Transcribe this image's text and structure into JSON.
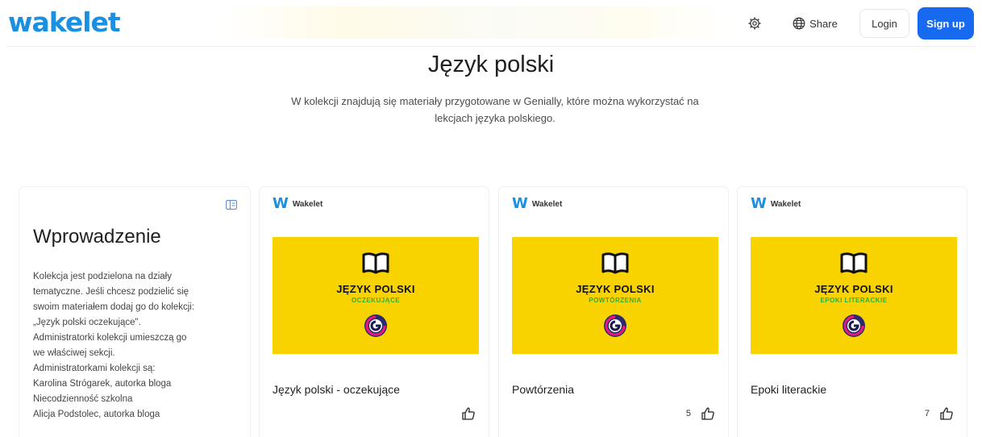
{
  "header": {
    "logo": "wakelet",
    "share_label": "Share",
    "login_label": "Login",
    "signup_label": "Sign up",
    "brand_color": "#1b8fe0",
    "signup_color": "#1769f0"
  },
  "collection": {
    "title": "Język polski",
    "description_lines": [
      "W kolekcji znajdują się materiały przygotowane w Genially, które można wykorzystać na",
      "lekcjach języka polskiego."
    ]
  },
  "intro": {
    "title": "Wprowadzenie",
    "lines": [
      "Kolekcja jest podzielona na działy",
      "tematyczne. Jeśli chcesz podzielić się",
      "swoim materiałem dodaj go do kolekcji:",
      "„Język polski oczekujące\".",
      "Administratorki kolekcji umieszczą go",
      "we właściwej sekcji.",
      "Administratorkami kolekcji są:",
      "Karolina Strógarek, autorka bloga",
      "Niecodzienność szkolna",
      "Alicja Podstolec, autorka bloga"
    ]
  },
  "cards": [
    {
      "source": "Wakelet",
      "thumb_title": "JĘZYK POLSKI",
      "thumb_subtitle": "OCZEKUJĄCE",
      "thumb_subtitle_color": "#2fae3b",
      "title": "Język polski - oczekujące",
      "likes": ""
    },
    {
      "source": "Wakelet",
      "thumb_title": "JĘZYK POLSKI",
      "thumb_subtitle": "POWTÓRZENIA",
      "thumb_subtitle_color": "#2fae3b",
      "title": "Powtórzenia",
      "likes": "5"
    },
    {
      "source": "Wakelet",
      "thumb_title": "JĘZYK POLSKI",
      "thumb_subtitle": "EPOKI LITERACKIE",
      "thumb_subtitle_color": "#2fae3b",
      "title": "Epoki literackie",
      "likes": "7"
    }
  ]
}
